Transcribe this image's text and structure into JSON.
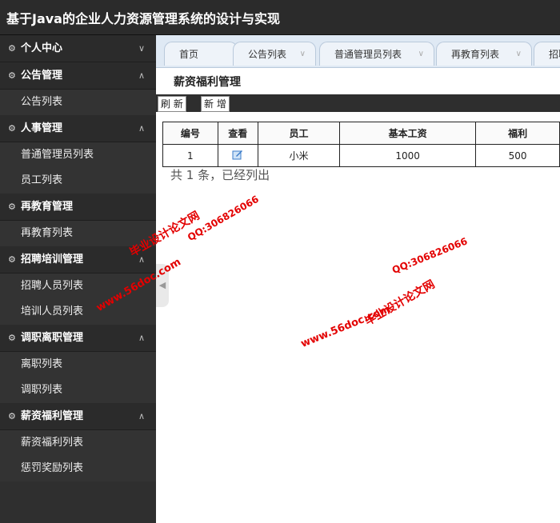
{
  "header": {
    "title": "基于Java的企业人力资源管理系统的设计与实现"
  },
  "sidebar": {
    "groups": [
      {
        "label": "个人中心",
        "chev": "∨",
        "items": []
      },
      {
        "label": "公告管理",
        "chev": "∧",
        "items": [
          "公告列表"
        ]
      },
      {
        "label": "人事管理",
        "chev": "∧",
        "items": [
          "普通管理员列表",
          "员工列表"
        ]
      },
      {
        "label": "再教育管理",
        "chev": "",
        "items": [
          "再教育列表"
        ]
      },
      {
        "label": "招聘培训管理",
        "chev": "∧",
        "items": [
          "招聘人员列表",
          "培训人员列表"
        ]
      },
      {
        "label": "调职离职管理",
        "chev": "∧",
        "items": [
          "离职列表",
          "调职列表"
        ]
      },
      {
        "label": "薪资福利管理",
        "chev": "∧",
        "items": [
          "薪资福利列表",
          "惩罚奖励列表"
        ]
      }
    ],
    "group_icon": "gear-icon",
    "collapse_glyph": "◀"
  },
  "tabs": [
    {
      "label": "首页",
      "chev": ""
    },
    {
      "label": "公告列表",
      "chev": "∨"
    },
    {
      "label": "普通管理员列表",
      "chev": "∨"
    },
    {
      "label": "再教育列表",
      "chev": "∨"
    },
    {
      "label": "招聘",
      "chev": ""
    }
  ],
  "page": {
    "title": "薪资福利管理",
    "refresh_label": "刷 新",
    "add_label": "新 增",
    "summary": "共 1 条，已经列出"
  },
  "table": {
    "headers": [
      "编号",
      "查看",
      "员工",
      "基本工资",
      "福利"
    ],
    "rows": [
      {
        "id": "1",
        "view_icon": "edit-icon",
        "employee": "小米",
        "base_salary": "1000",
        "welfare": "500"
      }
    ]
  },
  "watermark": {
    "text_site_name": "毕业设计论文网",
    "text_url": "www.56doc.com",
    "text_qq": "QQ:306826066",
    "color": "#e30000"
  },
  "colors": {
    "header_bg": "#2b2b2b",
    "sidebar_bg": "#2f2f2f",
    "tabbar_bg": "#dfe9f4",
    "toolbar_bg": "#2e2e2e"
  }
}
